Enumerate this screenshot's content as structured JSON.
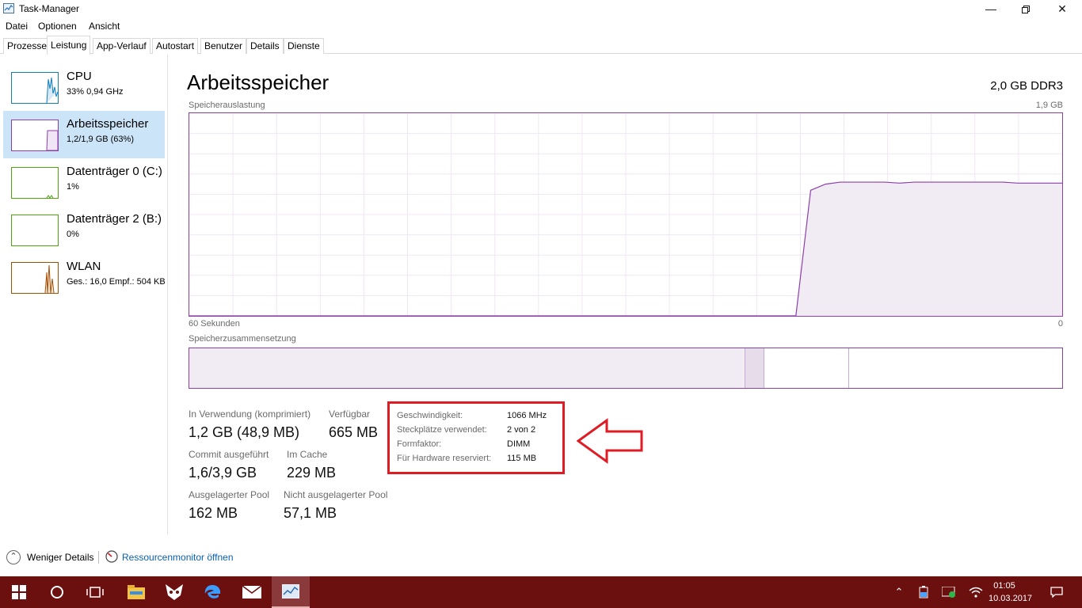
{
  "window": {
    "title": "Task-Manager"
  },
  "menu": [
    "Datei",
    "Optionen",
    "Ansicht"
  ],
  "tabs": [
    "Prozesse",
    "Leistung",
    "App-Verlauf",
    "Autostart",
    "Benutzer",
    "Details",
    "Dienste"
  ],
  "active_tab": "Leistung",
  "sidebar": [
    {
      "name": "CPU",
      "sub": "33% 0,94 GHz",
      "color": "#117dbb"
    },
    {
      "name": "Arbeitsspeicher",
      "sub": "1,2/1,9 GB (63%)",
      "color": "#8b3fa9"
    },
    {
      "name": "Datenträger 0 (C:)",
      "sub": "1%",
      "color": "#4da60c"
    },
    {
      "name": "Datenträger 2 (B:)",
      "sub": "0%",
      "color": "#4da60c"
    },
    {
      "name": "WLAN",
      "sub": "Ges.: 16,0 Empf.: 504 KB",
      "color": "#a74f01"
    }
  ],
  "main": {
    "title": "Arbeitsspeicher",
    "spec": "2,0 GB DDR3",
    "graph_label": "Speicherauslastung",
    "graph_max": "1,9 GB",
    "time_left": "60 Sekunden",
    "time_right": "0",
    "composition_label": "Speicherzusammensetzung"
  },
  "stats": {
    "in_use_label": "In Verwendung (komprimiert)",
    "in_use_value": "1,2 GB (48,9 MB)",
    "available_label": "Verfügbar",
    "available_value": "665 MB",
    "commit_label": "Commit ausgeführt",
    "commit_value": "1,6/3,9 GB",
    "cache_label": "Im Cache",
    "cache_value": "229 MB",
    "paged_label": "Ausgelagerter Pool",
    "paged_value": "162 MB",
    "nonpaged_label": "Nicht ausgelagerter Pool",
    "nonpaged_value": "57,1 MB"
  },
  "details": [
    {
      "label": "Geschwindigkeit:",
      "value": "1066 MHz"
    },
    {
      "label": "Steckplätze verwendet:",
      "value": "2 von 2"
    },
    {
      "label": "Formfaktor:",
      "value": "DIMM"
    },
    {
      "label": "Für Hardware reserviert:",
      "value": "115 MB"
    }
  ],
  "footer": {
    "fewer_details": "Weniger Details",
    "resource_monitor": "Ressourcenmonitor öffnen"
  },
  "taskbar": {
    "time": "01:05",
    "date": "10.03.2017",
    "apps": [
      "windows-start-icon",
      "cortana-circle-icon",
      "task-view-icon",
      "file-explorer-icon",
      "app-mask-icon",
      "edge-icon",
      "mail-icon",
      "task-manager-icon"
    ]
  },
  "chart_data": {
    "type": "area",
    "title": "Speicherauslastung",
    "unit": "GB",
    "ymax": 1.9,
    "xlabel_left": "60 Sekunden",
    "xlabel_right": "0",
    "series": [
      {
        "values_fraction_of_max": [
          0,
          0,
          0,
          0,
          0,
          0,
          0,
          0,
          0,
          0,
          0,
          0,
          0,
          0,
          0,
          0,
          0,
          0,
          0,
          0,
          0,
          0,
          0,
          0,
          0,
          0,
          0,
          0,
          0,
          0,
          0,
          0,
          0,
          0,
          0,
          0,
          0,
          0,
          0,
          0,
          0,
          0,
          0.62,
          0.65,
          0.66,
          0.66,
          0.66,
          0.66,
          0.655,
          0.66,
          0.66,
          0.66,
          0.66,
          0.66,
          0.66,
          0.66,
          0.655,
          0.655,
          0.655,
          0.655
        ]
      }
    ],
    "color": "#8b3fa9"
  }
}
